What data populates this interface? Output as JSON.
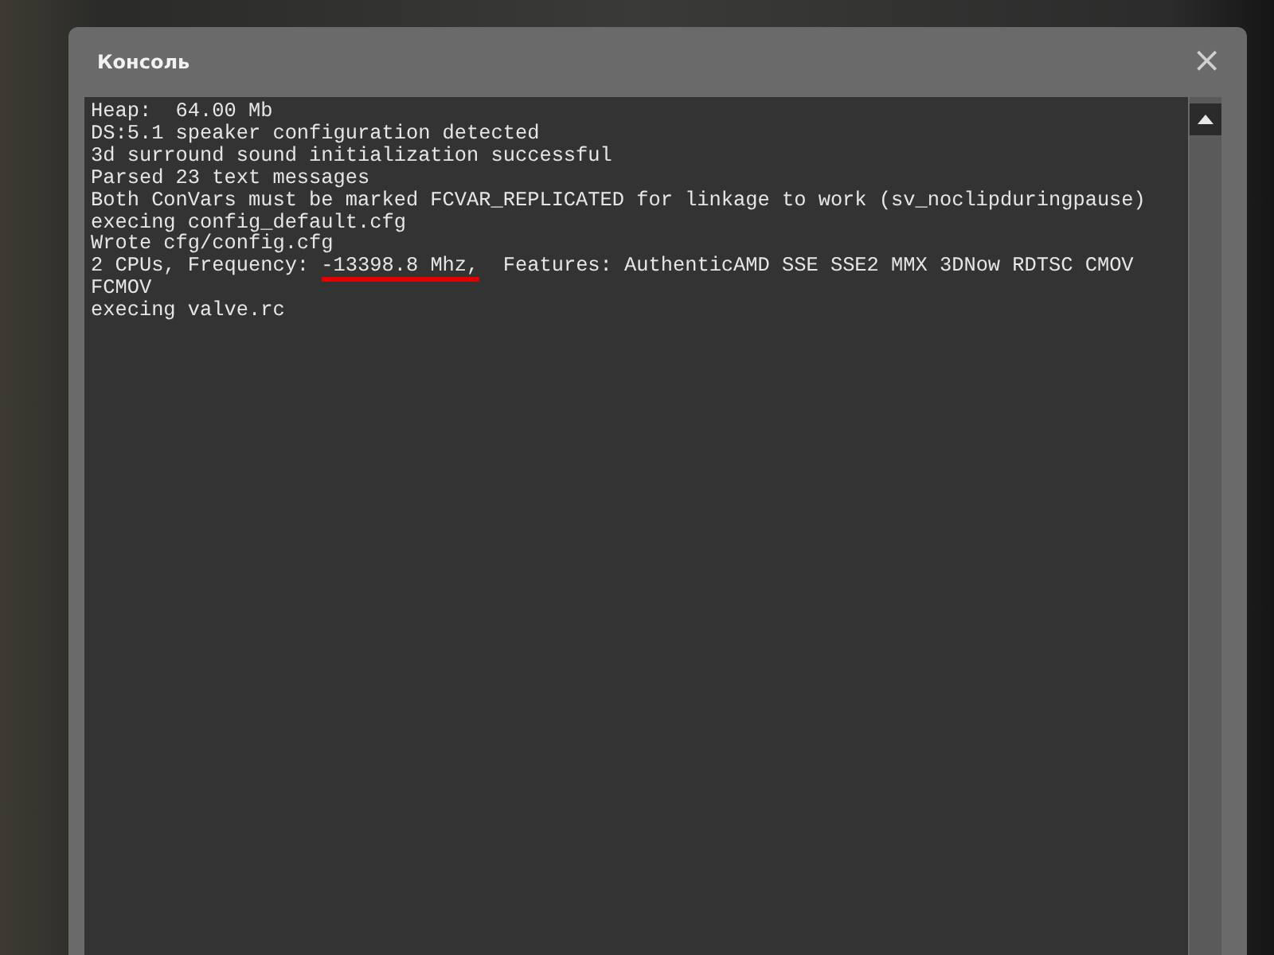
{
  "window": {
    "title": "Консоль",
    "close": "×"
  },
  "console": {
    "lines": [
      [
        {
          "text": "Heap:  64.00 Mb",
          "highlighted": false
        }
      ],
      [
        {
          "text": "DS:5.1 speaker configuration detected",
          "highlighted": false
        }
      ],
      [
        {
          "text": "3d surround sound initialization successful",
          "highlighted": false
        }
      ],
      [
        {
          "text": "Parsed 23 text messages",
          "highlighted": false
        }
      ],
      [
        {
          "text": "Both ConVars must be marked FCVAR_REPLICATED for linkage to work (sv_noclipduringpause)",
          "highlighted": false
        }
      ],
      [
        {
          "text": "execing config_default.cfg",
          "highlighted": false
        }
      ],
      [
        {
          "text": "Wrote cfg/config.cfg",
          "highlighted": false
        }
      ],
      [
        {
          "text": "2 CPUs, Frequency: ",
          "highlighted": false
        },
        {
          "text": "-13398.8 Mhz,",
          "highlighted": true
        },
        {
          "text": "  Features: AuthenticAMD SSE SSE2 MMX 3DNow RDTSC CMOV FCMOV",
          "highlighted": false
        }
      ],
      [
        {
          "text": "execing valve.rc",
          "highlighted": false
        }
      ]
    ]
  }
}
